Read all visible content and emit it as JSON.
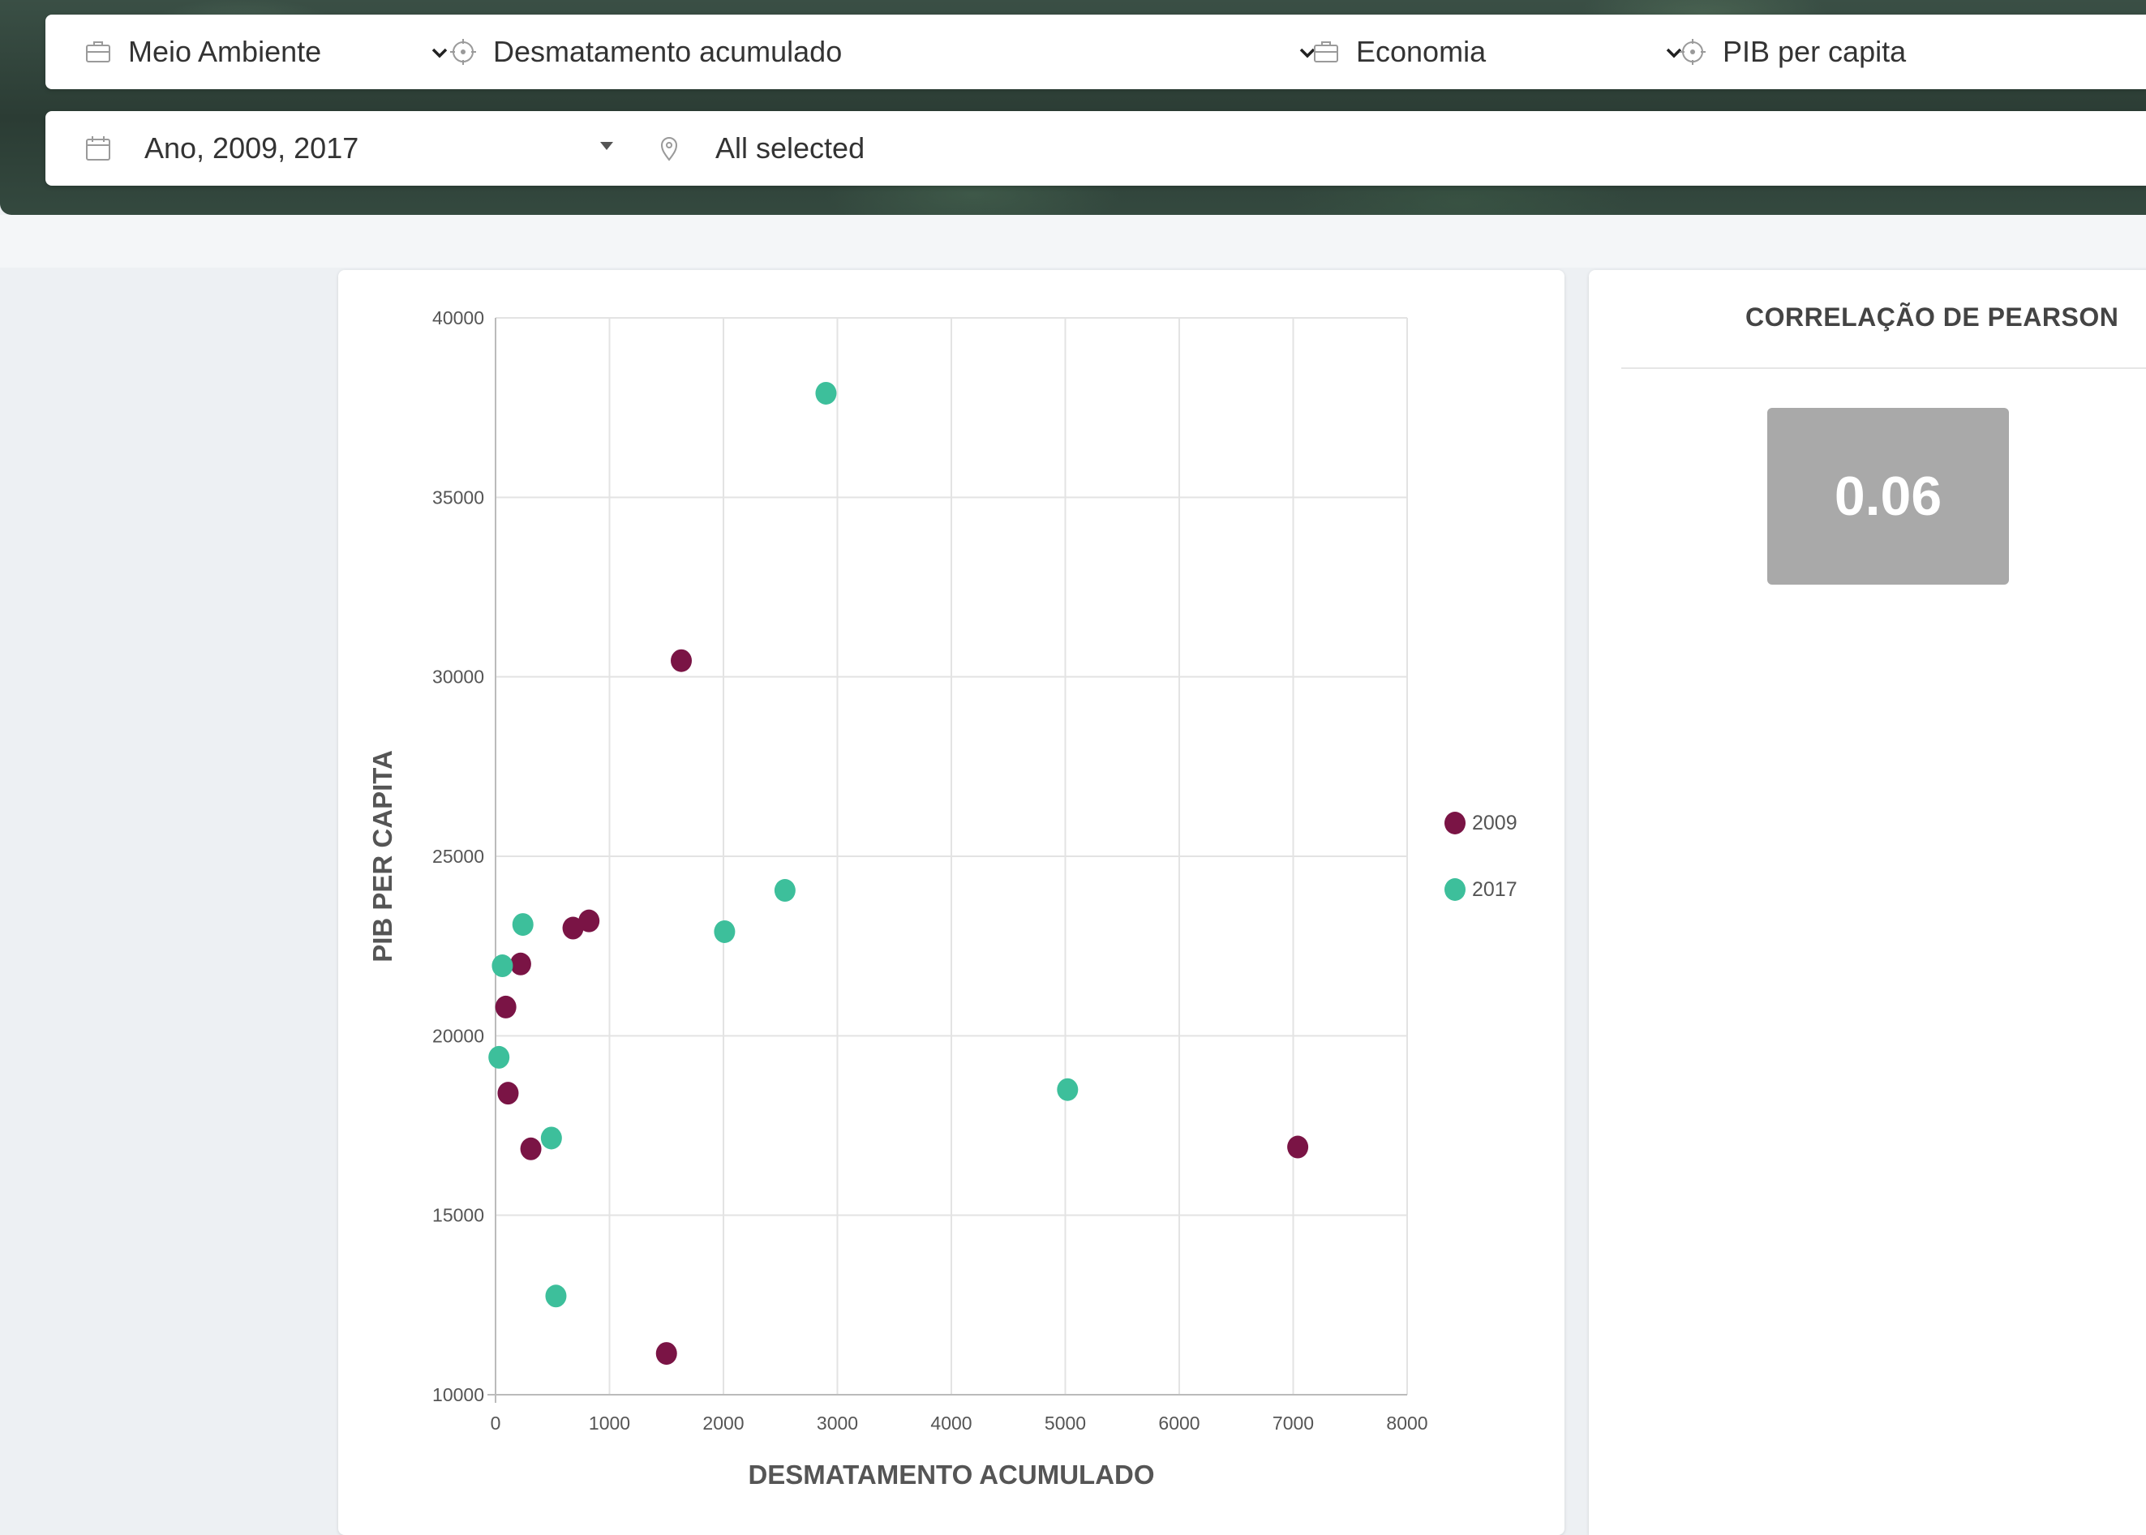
{
  "filters": {
    "theme1": {
      "label": "Meio Ambiente",
      "icon": "briefcase-icon"
    },
    "indicator1": {
      "label": "Desmatamento acumulado",
      "icon": "crosshair-icon"
    },
    "theme2": {
      "label": "Economia",
      "icon": "briefcase-icon"
    },
    "indicator2": {
      "label": "PIB per capita",
      "icon": "crosshair-icon"
    },
    "period": {
      "label": "Ano, 2009, 2017",
      "icon": "calendar-icon"
    },
    "location": {
      "label": "All selected",
      "icon": "map-pin-icon"
    }
  },
  "pearson": {
    "title": "CORRELAÇÃO DE PEARSON",
    "value": "0.06",
    "box_color": "#a9a9a9"
  },
  "chart_data": {
    "type": "scatter",
    "xlabel": "DESMATAMENTO ACUMULADO",
    "ylabel": "PIB PER CAPITA",
    "xlim": [
      0,
      8000
    ],
    "ylim": [
      10000,
      40000
    ],
    "xticks": [
      0,
      1000,
      2000,
      3000,
      4000,
      5000,
      6000,
      7000,
      8000
    ],
    "yticks": [
      10000,
      15000,
      20000,
      25000,
      30000,
      35000,
      40000
    ],
    "grid": true,
    "legend_position": "right",
    "series": [
      {
        "name": "2009",
        "color": "#7a1445",
        "points": [
          [
            1630,
            30450
          ],
          [
            820,
            23200
          ],
          [
            680,
            23000
          ],
          [
            220,
            22000
          ],
          [
            90,
            20800
          ],
          [
            110,
            18400
          ],
          [
            310,
            16850
          ],
          [
            1500,
            11150
          ],
          [
            7040,
            16900
          ]
        ]
      },
      {
        "name": "2017",
        "color": "#3dbf9b",
        "points": [
          [
            2900,
            37900
          ],
          [
            2540,
            24050
          ],
          [
            2010,
            22900
          ],
          [
            240,
            23100
          ],
          [
            60,
            21950
          ],
          [
            30,
            19400
          ],
          [
            490,
            17150
          ],
          [
            530,
            12750
          ],
          [
            5020,
            18500
          ]
        ]
      }
    ]
  }
}
